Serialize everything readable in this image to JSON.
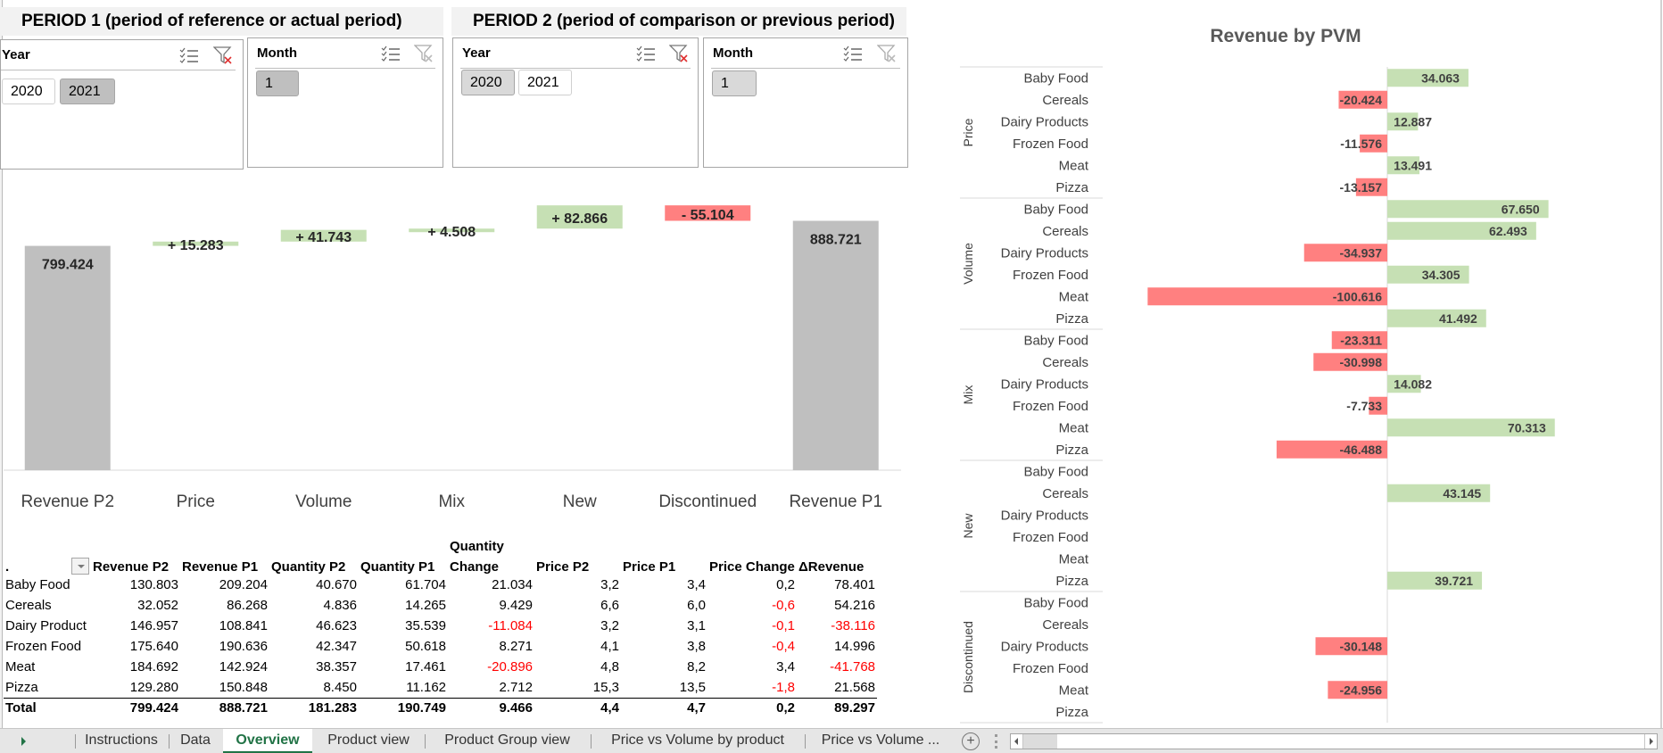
{
  "period1": {
    "title": "PERIOD 1 (period of reference or actual period)",
    "year_slicer": {
      "title": "Year",
      "items": [
        {
          "label": "2020",
          "selected": false
        },
        {
          "label": "2021",
          "selected": true
        }
      ]
    },
    "month_slicer": {
      "title": "Month",
      "items": [
        {
          "label": "1",
          "selected": true
        }
      ]
    }
  },
  "period2": {
    "title": "PERIOD 2 (period of comparison or previous period)",
    "year_slicer": {
      "title": "Year",
      "items": [
        {
          "label": "2020",
          "selected": true
        },
        {
          "label": "2021",
          "selected": false
        }
      ]
    },
    "month_slicer": {
      "title": "Month",
      "items": [
        {
          "label": "1",
          "selected": true
        }
      ]
    }
  },
  "icons": {
    "multi_select": "multi-select-icon",
    "clear_filter": "clear-filter-icon"
  },
  "colors": {
    "positive": "#c6e0b4",
    "negative": "#ff8080",
    "total": "#bfbfbf",
    "accent": "#217346",
    "negative_text": "#ff0000"
  },
  "chart_data": [
    {
      "type": "bar",
      "subtype": "waterfall",
      "title": "",
      "categories": [
        "Revenue P2",
        "Price",
        "Volume",
        "Mix",
        "New",
        "Discontinued",
        "Revenue P1"
      ],
      "values": [
        799.424,
        15.283,
        41.743,
        4.508,
        82.866,
        -55.104,
        888.721
      ],
      "kinds": [
        "total",
        "delta",
        "delta",
        "delta",
        "delta",
        "delta",
        "total"
      ],
      "data_labels": [
        "799.424",
        "+ 15.283",
        "+ 41.743",
        "+ 4.508",
        "+ 82.866",
        "- 55.104",
        "888.721"
      ],
      "xlabel": "",
      "ylabel": "",
      "grid": false,
      "legend": "none"
    },
    {
      "type": "bar",
      "subtype": "horizontal-grouped",
      "title": "Revenue by PVM",
      "groups": [
        "Price",
        "Volume",
        "Mix",
        "New",
        "Discontinued"
      ],
      "categories": [
        "Baby Food",
        "Cereals",
        "Dairy Products",
        "Frozen Food",
        "Meat",
        "Pizza"
      ],
      "series": [
        {
          "name": "Price",
          "values": [
            34.063,
            -20.424,
            12.887,
            -11.576,
            13.491,
            -13.157
          ]
        },
        {
          "name": "Volume",
          "values": [
            67.65,
            62.493,
            -34.937,
            34.305,
            -100.616,
            41.492
          ]
        },
        {
          "name": "Mix",
          "values": [
            -23.311,
            -30.998,
            14.082,
            -7.733,
            70.313,
            -46.488
          ]
        },
        {
          "name": "New",
          "values": [
            null,
            43.145,
            null,
            null,
            null,
            39.721
          ]
        },
        {
          "name": "Discontinued",
          "values": [
            null,
            null,
            -30.148,
            null,
            -24.956,
            null
          ]
        }
      ],
      "xlim": [
        -105,
        105
      ],
      "grid": false,
      "legend": "none"
    }
  ],
  "table": {
    "corner": ".",
    "headers": [
      "Revenue P2",
      "Revenue P1",
      "Quantity P2",
      "Quantity P1",
      "Quantity\nChange",
      "Price P2",
      "Price P1",
      "Price Change",
      "ΔRevenue"
    ],
    "header_qc_line1": "Quantity",
    "header_qc_line2": "Change",
    "rows": [
      {
        "label": "Baby Food",
        "cells": [
          "130.803",
          "209.204",
          "40.670",
          "61.704",
          "21.034",
          "3,2",
          "3,4",
          "0,2",
          "78.401"
        ]
      },
      {
        "label": "Cereals",
        "cells": [
          "32.052",
          "86.268",
          "4.836",
          "14.265",
          "9.429",
          "6,6",
          "6,0",
          "-0,6",
          "54.216"
        ]
      },
      {
        "label": "Dairy Product",
        "cells": [
          "146.957",
          "108.841",
          "46.623",
          "35.539",
          "-11.084",
          "3,2",
          "3,1",
          "-0,1",
          "-38.116"
        ]
      },
      {
        "label": "Frozen Food",
        "cells": [
          "175.640",
          "190.636",
          "42.347",
          "50.618",
          "8.271",
          "4,1",
          "3,8",
          "-0,4",
          "14.996"
        ]
      },
      {
        "label": "Meat",
        "cells": [
          "184.692",
          "142.924",
          "38.357",
          "17.461",
          "-20.896",
          "4,8",
          "8,2",
          "3,4",
          "-41.768"
        ]
      },
      {
        "label": "Pizza",
        "cells": [
          "129.280",
          "150.848",
          "8.450",
          "11.162",
          "2.712",
          "15,3",
          "13,5",
          "-1,8",
          "21.568"
        ]
      }
    ],
    "total": {
      "label": "Total",
      "cells": [
        "799.424",
        "888.721",
        "181.283",
        "190.749",
        "9.466",
        "4,4",
        "4,7",
        "0,2",
        "89.297"
      ]
    }
  },
  "sheet_tabs": [
    {
      "label": "Instructions",
      "active": false
    },
    {
      "label": "Data",
      "active": false
    },
    {
      "label": "Overview",
      "active": true
    },
    {
      "label": "Product view",
      "active": false
    },
    {
      "label": "Product Group view",
      "active": false
    },
    {
      "label": "Price vs Volume by product",
      "active": false
    },
    {
      "label": "Price vs Volume ...",
      "active": false
    }
  ],
  "add_sheet_label": "+"
}
